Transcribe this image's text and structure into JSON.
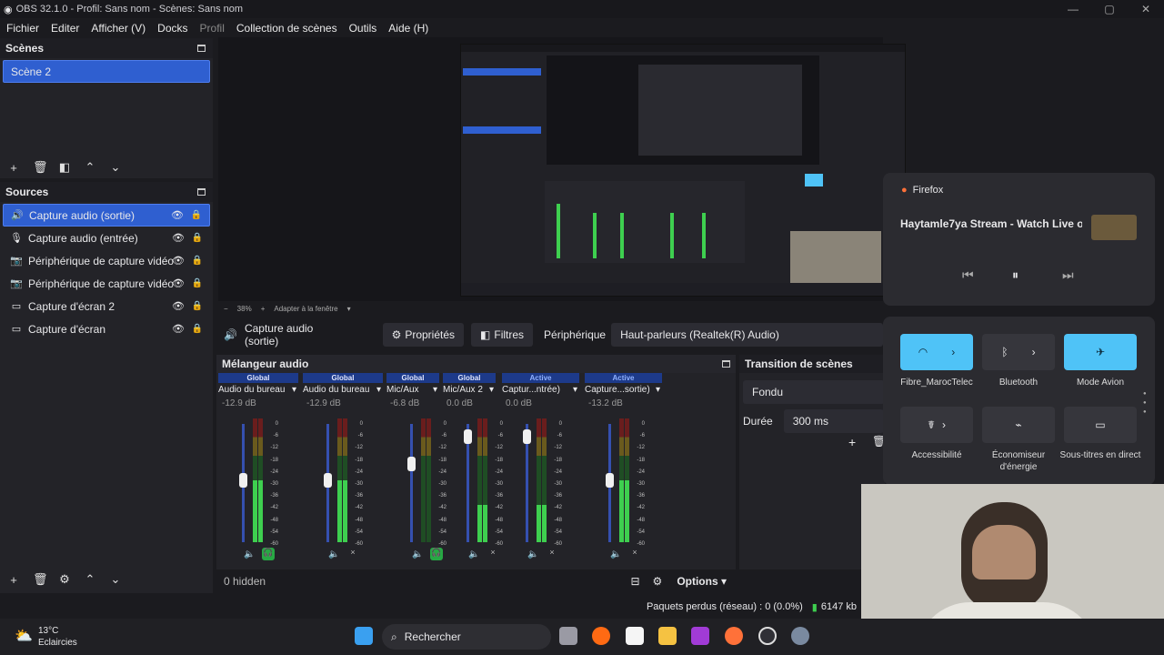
{
  "window": {
    "title": "OBS 32.1.0 - Profil: Sans nom - Scènes: Sans nom"
  },
  "menu": [
    "Fichier",
    "Editer",
    "Afficher (V)",
    "Docks",
    "Profil",
    "Collection de scènes",
    "Outils",
    "Aide (H)"
  ],
  "scenes": {
    "title": "Scènes",
    "items": [
      "Scène 2"
    ]
  },
  "sources": {
    "title": "Sources",
    "items": [
      {
        "label": "Capture audio (sortie)",
        "icon": "speaker-icon"
      },
      {
        "label": "Capture audio (entrée)",
        "icon": "microphone-icon"
      },
      {
        "label": "Périphérique de capture vidéo",
        "icon": "camera-icon"
      },
      {
        "label": "Périphérique de capture vidéo",
        "icon": "camera-icon"
      },
      {
        "label": "Capture d'écran 2",
        "icon": "monitor-icon"
      },
      {
        "label": "Capture d'écran",
        "icon": "monitor-icon"
      }
    ]
  },
  "preview": {
    "zoom": "38%",
    "fit": "Adapter à la fenêtre"
  },
  "propsbar": {
    "source": "Capture audio (sortie)",
    "properties": "Propriétés",
    "filters": "Filtres",
    "device_label": "Périphérique",
    "device_value": "Haut-parleurs (Realtek(R) Audio)"
  },
  "mixer": {
    "title": "Mélangeur audio",
    "channels": [
      {
        "badge": "Global",
        "name": "Audio du bureau",
        "db": "-12.9 dB",
        "level": 0.5,
        "fader": 0.55
      },
      {
        "badge": "Global",
        "name": "Audio du bureau",
        "db": "-12.9 dB",
        "level": 0.5,
        "fader": 0.55
      },
      {
        "badge": "Global",
        "name": "Mic/Aux",
        "db": "-6.8 dB",
        "level": 0.0,
        "fader": 0.7
      },
      {
        "badge": "Global",
        "name": "Mic/Aux 2",
        "db": "0.0 dB",
        "level": 0.3,
        "fader": 0.95
      },
      {
        "badge": "Active",
        "name": "Captur...ntrée)",
        "db": "0.0 dB",
        "level": 0.3,
        "fader": 0.95
      },
      {
        "badge": "Active",
        "name": "Capture...sortie)",
        "db": "-13.2 dB",
        "level": 0.5,
        "fader": 0.55
      }
    ],
    "scale": [
      "0",
      "-6",
      "-12",
      "-18",
      "-24",
      "-30",
      "-36",
      "-42",
      "-48",
      "-54",
      "-60"
    ],
    "hidden": "0 hidden",
    "options": "Options"
  },
  "transition": {
    "title": "Transition de scènes",
    "type": "Fondu",
    "duration_label": "Durée",
    "duration": "300 ms"
  },
  "status": {
    "dropped": "Paquets perdus (réseau) : 0 (0.0%)",
    "rate": "6147 kb"
  },
  "taskbar": {
    "weather_temp": "13°C",
    "weather_desc": "Eclaircies",
    "search": "Rechercher"
  },
  "media": {
    "app": "Firefox",
    "title": "Haytamle7ya Stream - Watch Live o..."
  },
  "quick": [
    {
      "label": "Fibre_MarocTelec",
      "active": true
    },
    {
      "label": "Bluetooth",
      "active": false
    },
    {
      "label": "Mode Avion",
      "active": true
    },
    {
      "label": "Accessibilité",
      "active": false
    },
    {
      "label": "Économiseur d'énergie",
      "active": false
    },
    {
      "label": "Sous-titres en direct",
      "active": false
    }
  ],
  "colors": {
    "accent": "#2f5fd0",
    "panel": "#232328",
    "quick_active": "#4fc3f7",
    "meter_green": "#3ecf4f"
  }
}
